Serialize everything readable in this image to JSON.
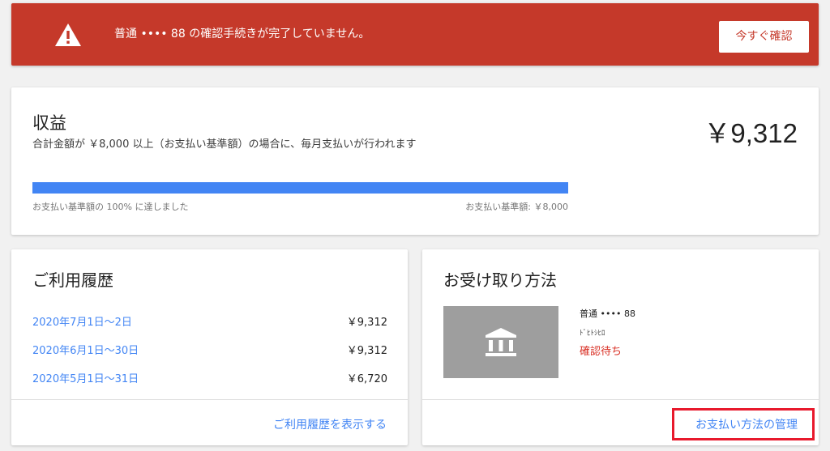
{
  "alert": {
    "message": "普通 •••• 88 の確認手続きが完了していません。",
    "button": "今すぐ確認",
    "color": "#c5392a"
  },
  "earnings": {
    "title": "収益",
    "description": "合計金額が ￥8,000 以上（お支払い基準額）の場合に、毎月支払いが行われます",
    "amount": "￥9,312",
    "progress_percent": 100,
    "progress_label": "お支払い基準額の 100% に達しました",
    "threshold_label": "お支払い基準額: ￥8,000",
    "bar_color": "#4285f4"
  },
  "history": {
    "title": "ご利用履歴",
    "rows": [
      {
        "period": "2020年7月1日〜2日",
        "value": "￥9,312"
      },
      {
        "period": "2020年6月1日〜30日",
        "value": "￥9,312"
      },
      {
        "period": "2020年5月1日〜31日",
        "value": "￥6,720"
      }
    ],
    "view_link": "ご利用履歴を表示する"
  },
  "payment": {
    "title": "お受け取り方法",
    "icon": "bank-icon",
    "account": "普通 •••• 88",
    "holder": "ﾄﾞﾋﾄｼﾋﾛ",
    "status": "確認待ち",
    "manage_link": "お支払い方法の管理"
  }
}
